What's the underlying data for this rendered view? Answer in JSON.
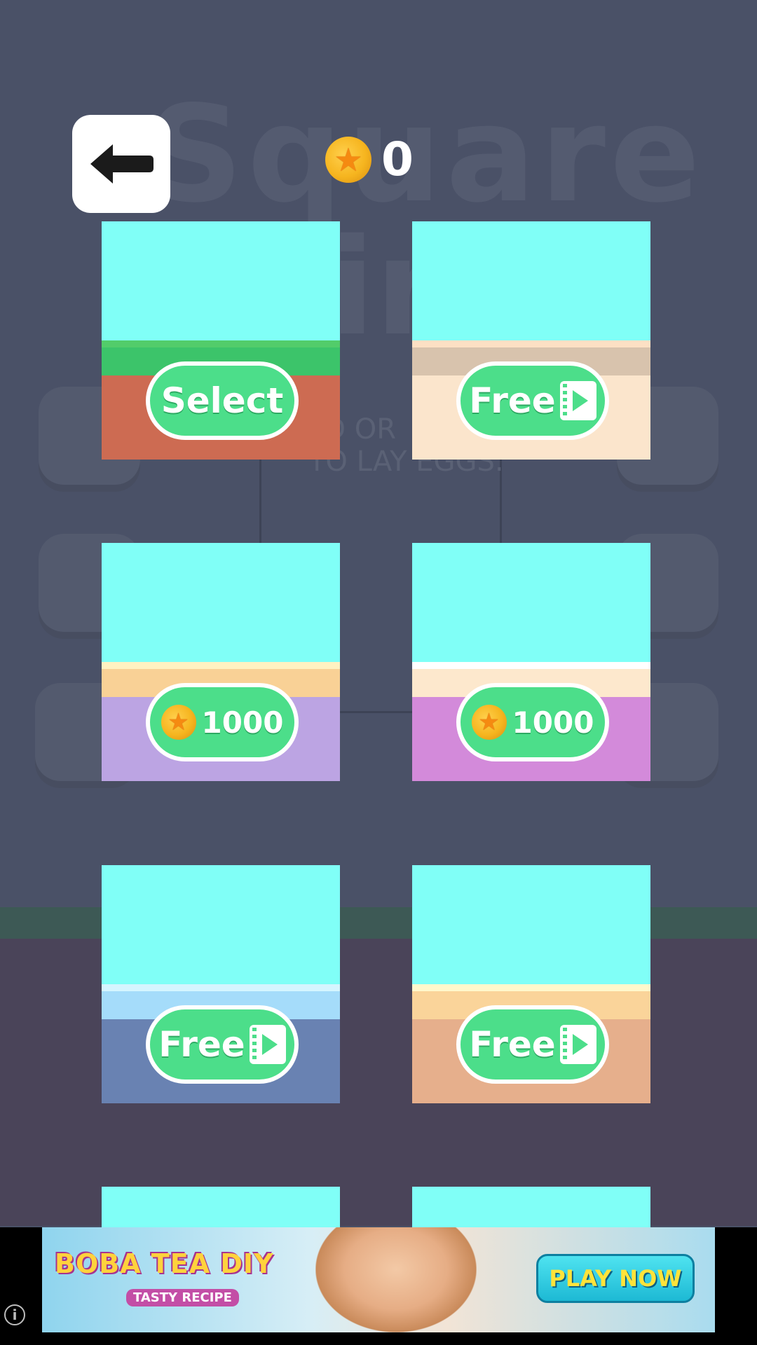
{
  "background": {
    "title": "Square",
    "title_part2": "ir",
    "panel_text_line1": "LD OR",
    "panel_text_line2": "TO LAY EGGS."
  },
  "header": {
    "back_icon": "arrow-left-icon",
    "coin_icon": "star-coin-icon",
    "coins": "0"
  },
  "themes": [
    {
      "action": "Select",
      "type": "select",
      "sky": "#80fff7",
      "bands": [
        "#52cc6a",
        "#3cc46a",
        "#cd6b52"
      ]
    },
    {
      "action": "Free",
      "type": "video",
      "sky": "#80fff7",
      "bands": [
        "#fde0c4",
        "#d8c3ad",
        "#fbe5cc"
      ]
    },
    {
      "action": "1000",
      "type": "coins",
      "sky": "#80fff7",
      "bands": [
        "#fff2c2",
        "#f9d196",
        "#bca4e3"
      ]
    },
    {
      "action": "1000",
      "type": "coins",
      "sky": "#80fff7",
      "bands": [
        "#ffffff",
        "#fde8cd",
        "#d38ada"
      ]
    },
    {
      "action": "Free",
      "type": "video",
      "sky": "#80fff7",
      "bands": [
        "#d5f5ff",
        "#a5dcfa",
        "#6982b2"
      ]
    },
    {
      "action": "Free",
      "type": "video",
      "sky": "#80fff7",
      "bands": [
        "#fff8cc",
        "#fad49a",
        "#e6af8c"
      ]
    },
    {
      "action": "",
      "type": "partial",
      "sky": "#80fff7",
      "bands": []
    },
    {
      "action": "",
      "type": "partial",
      "sky": "#80fff7",
      "bands": []
    }
  ],
  "ad": {
    "logo_text": "BOBA TEA DIY",
    "sub_text": "TASTY RECIPE",
    "cta": "PLAY NOW",
    "info": "i"
  }
}
